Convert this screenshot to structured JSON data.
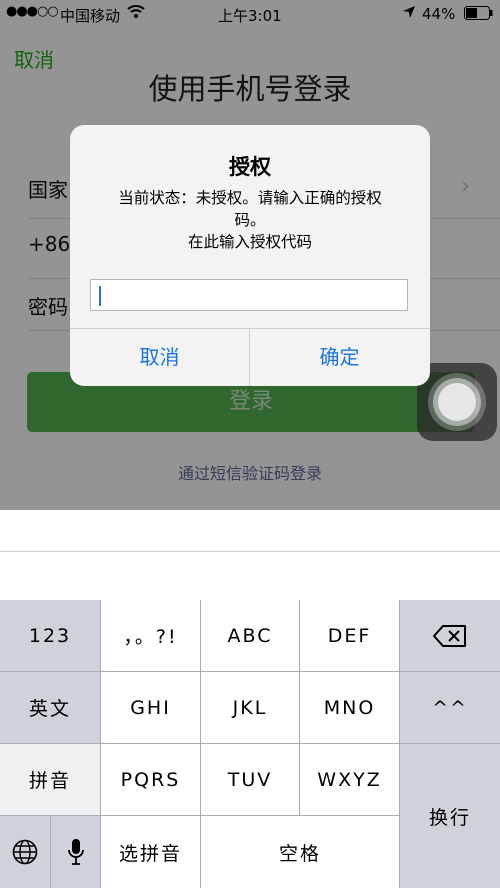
{
  "status": {
    "signal": "●●●○○",
    "carrier": "中国移动",
    "time": "上午3:01",
    "battery": "44%"
  },
  "page": {
    "cancel": "取消",
    "title": "使用手机号登录",
    "country_label": "国家",
    "code": "+86",
    "password_label": "密码",
    "login": "登录",
    "sms_login": "通过短信验证码登录"
  },
  "alert": {
    "title": "授权",
    "message_line1": "当前状态：未授权。请输入正确的授权",
    "message_line2": "码。",
    "message_line3": "在此输入授权代码",
    "input_value": "",
    "cancel": "取消",
    "confirm": "确定"
  },
  "keyboard": {
    "k123": "123",
    "punct": "，。?!",
    "abc": "ABC",
    "def": "DEF",
    "english": "英文",
    "ghi": "GHI",
    "jkl": "JKL",
    "mno": "MNO",
    "face": "^^",
    "pinyin": "拼音",
    "pqrs": "PQRS",
    "tuv": "TUV",
    "wxyz": "WXYZ",
    "newline": "换行",
    "select_pinyin": "选拼音",
    "space": "空格"
  },
  "colors": {
    "accent_green": "#1aad19",
    "button_blue": "#1a73e8",
    "link_blue": "#576b95"
  }
}
